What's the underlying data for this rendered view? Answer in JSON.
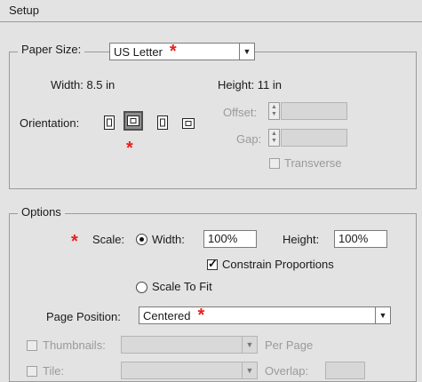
{
  "header": {
    "title": "Setup"
  },
  "paper_size": {
    "label": "Paper Size:",
    "value": "US Letter",
    "width_label": "Width: 8.5 in",
    "height_label": "Height: 11 in",
    "orientation_label": "Orientation:",
    "orientation_selected": "landscape",
    "offset_label": "Offset:",
    "gap_label": "Gap:",
    "transverse_label": "Transverse",
    "transverse_checked": false
  },
  "options": {
    "legend": "Options",
    "scale_label": "Scale:",
    "width_radio_label": "Width:",
    "width_value": "100%",
    "height_label": "Height:",
    "height_value": "100%",
    "constrain_label": "Constrain Proportions",
    "constrain_checked": true,
    "scale_to_fit_label": "Scale To Fit",
    "scale_mode": "width",
    "page_position_label": "Page Position:",
    "page_position_value": "Centered",
    "thumbnails_label": "Thumbnails:",
    "per_page_label": "Per Page",
    "tile_label": "Tile:",
    "overlap_label": "Overlap:"
  },
  "annotations": {
    "star_glyph": "*",
    "star_color": "#e8201c"
  },
  "icons": {
    "select_arrow": "chevron-down-icon",
    "orientation": [
      "portrait-icon",
      "landscape-icon",
      "reverse-portrait-icon",
      "reverse-landscape-icon"
    ]
  }
}
